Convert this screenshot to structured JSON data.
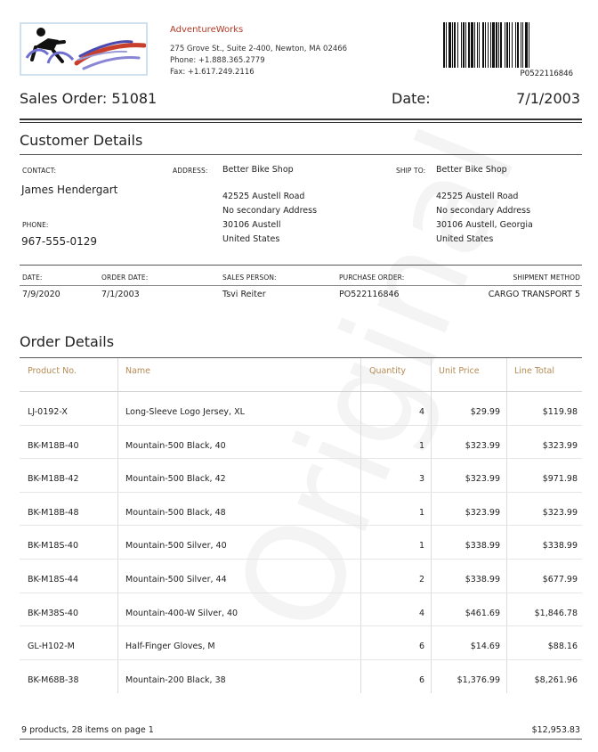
{
  "company": {
    "name": "AdventureWorks",
    "address": "275 Grove St., Suite 2-400, Newton, MA 02466",
    "phone": "Phone: +1.888.365.2779",
    "fax": "Fax: +1.617.249.2116"
  },
  "barcode_text": "PO522116846",
  "sales_order": {
    "label": "Sales Order: 51081",
    "date_label": "Date:",
    "date_value": "7/1/2003"
  },
  "customer": {
    "title": "Customer Details",
    "contact_label": "CONTACT:",
    "contact_name": "James Hendergart",
    "phone_label": "PHONE:",
    "phone": "967-555-0129",
    "address_label": "ADDRESS:",
    "address": [
      "Better Bike Shop",
      "42525 Austell Road",
      "No secondary Address",
      "30106 Austell",
      "United States"
    ],
    "shipto_label": "SHIP TO:",
    "shipto": [
      "Better Bike Shop",
      "42525 Austell Road",
      "No secondary Address",
      "30106 Austell, Georgia",
      "United States"
    ]
  },
  "order_info": {
    "labels": [
      "DATE:",
      "ORDER DATE:",
      "SALES PERSON:",
      "PURCHASE ORDER:",
      "SHIPMENT METHOD"
    ],
    "values": [
      "7/9/2020",
      "7/1/2003",
      "Tsvi Reiter",
      "PO522116846",
      "CARGO TRANSPORT 5"
    ]
  },
  "order_details": {
    "title": "Order Details",
    "headers": [
      "Product No.",
      "Name",
      "Quantity",
      "Unit Price",
      "Line Total"
    ],
    "rows": [
      [
        "LJ-0192-X",
        "Long-Sleeve Logo Jersey, XL",
        "4",
        "$29.99",
        "$119.98"
      ],
      [
        "BK-M18B-40",
        "Mountain-500 Black, 40",
        "1",
        "$323.99",
        "$323.99"
      ],
      [
        "BK-M18B-42",
        "Mountain-500 Black, 42",
        "3",
        "$323.99",
        "$971.98"
      ],
      [
        "BK-M18B-48",
        "Mountain-500 Black, 48",
        "1",
        "$323.99",
        "$323.99"
      ],
      [
        "BK-M18S-40",
        "Mountain-500 Silver, 40",
        "1",
        "$338.99",
        "$338.99"
      ],
      [
        "BK-M18S-44",
        "Mountain-500 Silver, 44",
        "2",
        "$338.99",
        "$677.99"
      ],
      [
        "BK-M38S-40",
        "Mountain-400-W Silver, 40",
        "4",
        "$461.69",
        "$1,846.78"
      ],
      [
        "GL-H102-M",
        "Half-Finger Gloves, M",
        "6",
        "$14.69",
        "$88.16"
      ],
      [
        "BK-M68B-38",
        "Mountain-200 Black, 38",
        "6",
        "$1,376.99",
        "$8,261.96"
      ]
    ],
    "summary": "9 products, 28 items on page  1",
    "total": "$12,953.83"
  },
  "watermark": "Original",
  "colors": {
    "brand": "#b23a25",
    "header_text": "#b58b54"
  },
  "icons": {
    "logo": "cyclist-logo-icon",
    "barcode": "barcode-icon"
  }
}
